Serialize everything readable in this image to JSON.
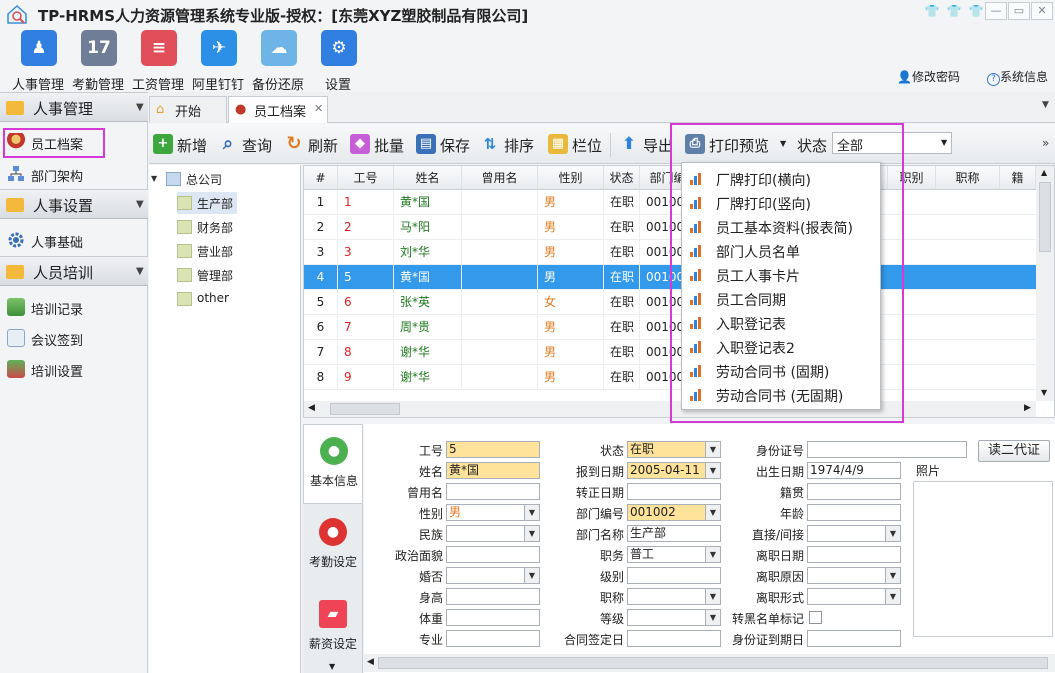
{
  "window": {
    "title": "TP-HRMS人力资源管理系统专业版-授权：[东莞XYZ塑胶制品有限公司]"
  },
  "modules": [
    {
      "label": "人事管理",
      "icon": "users-icon",
      "color": "#2f7ee0"
    },
    {
      "label": "考勤管理",
      "icon": "calendar-icon",
      "color": "#6f7d96"
    },
    {
      "label": "工资管理",
      "icon": "payroll-icon",
      "color": "#e04e5a"
    },
    {
      "label": "阿里钉钉",
      "icon": "dingtalk-icon",
      "color": "#2b8fe6"
    },
    {
      "label": "备份还原",
      "icon": "cloud-icon",
      "color": "#6fb4e6"
    },
    {
      "label": "设置",
      "icon": "gear-icon",
      "color": "#2f7ee0"
    }
  ],
  "toplinks": {
    "change_password": "修改密码",
    "system_info": "系统信息"
  },
  "sidebar": {
    "sections": [
      {
        "label": "人事管理",
        "items": [
          {
            "label": "员工档案"
          },
          {
            "label": "部门架构"
          }
        ]
      },
      {
        "label": "人事设置",
        "items": [
          {
            "label": "人事基础"
          }
        ]
      },
      {
        "label": "人员培训",
        "items": [
          {
            "label": "培训记录"
          },
          {
            "label": "会议签到"
          },
          {
            "label": "培训设置"
          }
        ]
      }
    ]
  },
  "tabs": [
    {
      "label": "开始"
    },
    {
      "label": "员工档案"
    }
  ],
  "toolbar": {
    "add": "新增",
    "query": "查询",
    "refresh": "刷新",
    "batch": "批量",
    "save": "保存",
    "sort": "排序",
    "columns": "栏位",
    "export": "导出",
    "print_preview": "打印预览",
    "status_label": "状态",
    "status_value": "全部"
  },
  "tree": {
    "root": "总公司",
    "children": [
      {
        "label": "生产部"
      },
      {
        "label": "财务部"
      },
      {
        "label": "营业部"
      },
      {
        "label": "管理部"
      },
      {
        "label": "other"
      }
    ]
  },
  "grid": {
    "headers": [
      "#",
      "工号",
      "姓名",
      "曾用名",
      "性别",
      "状态",
      "部门编号",
      "",
      "职别",
      "职称",
      "籍"
    ],
    "rows": [
      {
        "idx": "1",
        "id": "1",
        "name": "黄*国",
        "alias": "",
        "gender": "男",
        "status": "在职",
        "dept": "001002"
      },
      {
        "idx": "2",
        "id": "2",
        "name": "马*阳",
        "alias": "",
        "gender": "男",
        "status": "在职",
        "dept": "001002"
      },
      {
        "idx": "3",
        "id": "3",
        "name": "刘*华",
        "alias": "",
        "gender": "男",
        "status": "在职",
        "dept": "001002"
      },
      {
        "idx": "4",
        "id": "5",
        "name": "黄*国",
        "alias": "",
        "gender": "男",
        "status": "在职",
        "dept": "001002"
      },
      {
        "idx": "5",
        "id": "6",
        "name": "张*英",
        "alias": "",
        "gender": "女",
        "status": "在职",
        "dept": "001002"
      },
      {
        "idx": "6",
        "id": "7",
        "name": "周*贵",
        "alias": "",
        "gender": "男",
        "status": "在职",
        "dept": "001002"
      },
      {
        "idx": "7",
        "id": "8",
        "name": "谢*华",
        "alias": "",
        "gender": "男",
        "status": "在职",
        "dept": "001002"
      },
      {
        "idx": "8",
        "id": "9",
        "name": "谢*华",
        "alias": "",
        "gender": "男",
        "status": "在职",
        "dept": "001002"
      }
    ],
    "selected_row": 4
  },
  "print_menu": {
    "items": [
      {
        "label": "厂牌打印(横向)"
      },
      {
        "label": "厂牌打印(竖向)"
      },
      {
        "label": "员工基本资料(报表简)"
      },
      {
        "label": "部门人员名单"
      },
      {
        "label": "员工人事卡片"
      },
      {
        "label": "员工合同期"
      },
      {
        "label": "入职登记表"
      },
      {
        "label": "入职登记表2"
      },
      {
        "label": "劳动合同书 (固期)"
      },
      {
        "label": "劳动合同书 (无固期)"
      }
    ]
  },
  "detail_tabs": [
    {
      "label": "基本信息"
    },
    {
      "label": "考勤设定"
    },
    {
      "label": "薪资设定"
    }
  ],
  "form": {
    "col1": [
      {
        "label": "工号",
        "value": "5",
        "yellow": true,
        "dd": false
      },
      {
        "label": "姓名",
        "value": "黄*国",
        "yellow": true,
        "dd": false
      },
      {
        "label": "曾用名",
        "value": "",
        "yellow": false,
        "dd": false
      },
      {
        "label": "性别",
        "value": "男",
        "yellow": false,
        "dd": true
      },
      {
        "label": "民族",
        "value": "",
        "yellow": false,
        "dd": true
      },
      {
        "label": "政治面貌",
        "value": "",
        "yellow": false,
        "dd": false
      },
      {
        "label": "婚否",
        "value": "",
        "yellow": false,
        "dd": true
      },
      {
        "label": "身高",
        "value": "",
        "yellow": false,
        "dd": false
      },
      {
        "label": "体重",
        "value": "",
        "yellow": false,
        "dd": false
      },
      {
        "label": "专业",
        "value": "",
        "yellow": false,
        "dd": false
      }
    ],
    "col2": [
      {
        "label": "状态",
        "value": "在职",
        "yellow": true,
        "dd": true
      },
      {
        "label": "报到日期",
        "value": "2005-04-11",
        "yellow": true,
        "dd": true
      },
      {
        "label": "转正日期",
        "value": "",
        "yellow": false,
        "dd": false
      },
      {
        "label": "部门编号",
        "value": "001002",
        "yellow": true,
        "dd": true
      },
      {
        "label": "部门名称",
        "value": "生产部",
        "yellow": false,
        "dd": false
      },
      {
        "label": "职务",
        "value": "普工",
        "yellow": false,
        "dd": true
      },
      {
        "label": "级别",
        "value": "",
        "yellow": false,
        "dd": false
      },
      {
        "label": "职称",
        "value": "",
        "yellow": false,
        "dd": true
      },
      {
        "label": "等级",
        "value": "",
        "yellow": false,
        "dd": true
      },
      {
        "label": "合同签定日",
        "value": "",
        "yellow": false,
        "dd": false
      }
    ],
    "col3": [
      {
        "label": "身份证号",
        "value": "",
        "yellow": false,
        "dd": false
      },
      {
        "label": "出生日期",
        "value": "1974/4/9",
        "yellow": false,
        "dd": false
      },
      {
        "label": "籍贯",
        "value": "",
        "yellow": false,
        "dd": false
      },
      {
        "label": "年龄",
        "value": "",
        "yellow": false,
        "dd": false
      },
      {
        "label": "直接/间接",
        "value": "",
        "yellow": false,
        "dd": true
      },
      {
        "label": "离职日期",
        "value": "",
        "yellow": false,
        "dd": false
      },
      {
        "label": "离职原因",
        "value": "",
        "yellow": false,
        "dd": true
      },
      {
        "label": "离职形式",
        "value": "",
        "yellow": false,
        "dd": true
      },
      {
        "label": "转黑名单标记",
        "value": "",
        "yellow": false,
        "dd": false
      },
      {
        "label": "身份证到期日",
        "value": "",
        "yellow": false,
        "dd": false
      }
    ],
    "read_id_button": "读二代证",
    "photo_label": "照片"
  },
  "colors": {
    "selection": "#3399ea",
    "highlight": "#d53ad6",
    "field_yellow": "#ffe39a",
    "id_red": "#e02020",
    "name_green": "#1f7a1f",
    "gender_orange": "#e07a20"
  }
}
